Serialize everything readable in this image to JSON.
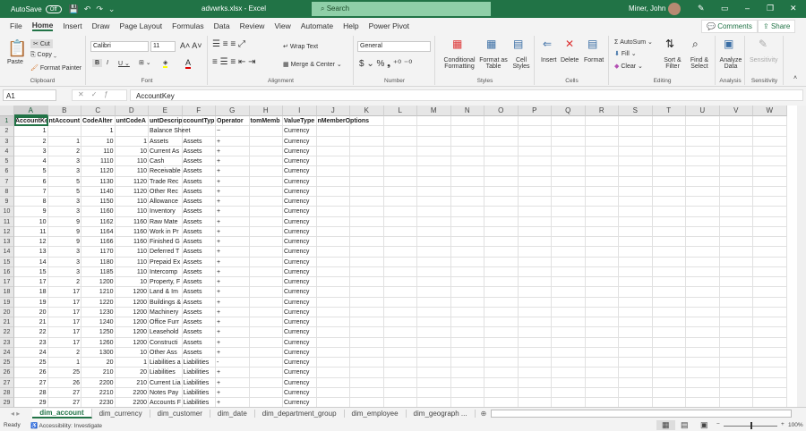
{
  "titlebar": {
    "autosave_label": "AutoSave",
    "autosave_state": "Off",
    "filename": "advwrks.xlsx - Excel",
    "search_placeholder": "Search",
    "user": "Miner, John"
  },
  "menu": {
    "tabs": [
      "File",
      "Home",
      "Insert",
      "Draw",
      "Page Layout",
      "Formulas",
      "Data",
      "Review",
      "View",
      "Automate",
      "Help",
      "Power Pivot"
    ],
    "active": "Home",
    "comments": "Comments",
    "share": "Share"
  },
  "ribbon": {
    "clipboard": {
      "label": "Clipboard",
      "paste": "Paste",
      "cut": "Cut",
      "copy": "Copy",
      "format_painter": "Format Painter"
    },
    "font": {
      "label": "Font",
      "name": "Calibri",
      "size": "11",
      "font_color": "#e00000",
      "fill_color": "#ffff00"
    },
    "alignment": {
      "label": "Alignment",
      "wrap": "Wrap Text",
      "merge": "Merge & Center"
    },
    "number": {
      "label": "Number",
      "format": "General"
    },
    "styles": {
      "label": "Styles",
      "conditional": "Conditional Formatting",
      "table": "Format as Table",
      "cell_styles": "Cell Styles"
    },
    "cells": {
      "label": "Cells",
      "insert": "Insert",
      "delete": "Delete",
      "format": "Format"
    },
    "editing": {
      "label": "Editing",
      "autosum": "AutoSum",
      "fill": "Fill",
      "clear": "Clear",
      "sort": "Sort & Filter",
      "find": "Find & Select"
    },
    "analysis": {
      "label": "Analysis",
      "analyze": "Analyze Data"
    },
    "sensitivity": {
      "label": "Sensitivity",
      "button": "Sensitivity"
    }
  },
  "formula_bar": {
    "name_box": "A1",
    "value": "AccountKey"
  },
  "sheet": {
    "columns": [
      "A",
      "B",
      "C",
      "D",
      "E",
      "F",
      "G",
      "H",
      "I",
      "J",
      "K",
      "L",
      "M",
      "N",
      "O",
      "P",
      "Q",
      "R",
      "S",
      "T",
      "U",
      "V",
      "W"
    ],
    "selected_cell": "A1",
    "header_row": [
      "AccountKe",
      "ntAccount",
      "CodeAlter",
      "untCodeA",
      "untDescrip",
      "ccountTyp",
      "Operator",
      "tomMemb",
      "ValueType",
      "nMemberOptions"
    ],
    "rows": [
      [
        1,
        "",
        1,
        "",
        "Balance Sheet",
        "",
        "~",
        "",
        "Currency"
      ],
      [
        2,
        1,
        10,
        1,
        "Assets",
        "Assets",
        "+",
        "",
        "Currency"
      ],
      [
        3,
        2,
        110,
        10,
        "Current As",
        "Assets",
        "+",
        "",
        "Currency"
      ],
      [
        4,
        3,
        1110,
        110,
        "Cash",
        "Assets",
        "+",
        "",
        "Currency"
      ],
      [
        5,
        3,
        1120,
        110,
        "Receivable",
        "Assets",
        "+",
        "",
        "Currency"
      ],
      [
        6,
        5,
        1130,
        1120,
        "Trade Rec",
        "Assets",
        "+",
        "",
        "Currency"
      ],
      [
        7,
        5,
        1140,
        1120,
        "Other Rec",
        "Assets",
        "+",
        "",
        "Currency"
      ],
      [
        8,
        3,
        1150,
        110,
        "Allowance",
        "Assets",
        "+",
        "",
        "Currency"
      ],
      [
        9,
        3,
        1160,
        110,
        "Inventory",
        "Assets",
        "+",
        "",
        "Currency"
      ],
      [
        10,
        9,
        1162,
        1160,
        "Raw Mate",
        "Assets",
        "+",
        "",
        "Currency"
      ],
      [
        11,
        9,
        1164,
        1160,
        "Work in Pr",
        "Assets",
        "+",
        "",
        "Currency"
      ],
      [
        12,
        9,
        1166,
        1160,
        "Finished G",
        "Assets",
        "+",
        "",
        "Currency"
      ],
      [
        13,
        3,
        1170,
        110,
        "Deferred T",
        "Assets",
        "+",
        "",
        "Currency"
      ],
      [
        14,
        3,
        1180,
        110,
        "Prepaid Ex",
        "Assets",
        "+",
        "",
        "Currency"
      ],
      [
        15,
        3,
        1185,
        110,
        "Intercomp",
        "Assets",
        "+",
        "",
        "Currency"
      ],
      [
        17,
        2,
        1200,
        10,
        "Property, F",
        "Assets",
        "+",
        "",
        "Currency"
      ],
      [
        18,
        17,
        1210,
        1200,
        "Land & Im",
        "Assets",
        "+",
        "",
        "Currency"
      ],
      [
        19,
        17,
        1220,
        1200,
        "Buildings &",
        "Assets",
        "+",
        "",
        "Currency"
      ],
      [
        20,
        17,
        1230,
        1200,
        "Machinery",
        "Assets",
        "+",
        "",
        "Currency"
      ],
      [
        21,
        17,
        1240,
        1200,
        "Office Furr",
        "Assets",
        "+",
        "",
        "Currency"
      ],
      [
        22,
        17,
        1250,
        1200,
        "Leasehold",
        "Assets",
        "+",
        "",
        "Currency"
      ],
      [
        23,
        17,
        1260,
        1200,
        "Constructi",
        "Assets",
        "+",
        "",
        "Currency"
      ],
      [
        24,
        2,
        1300,
        10,
        "Other Ass",
        "Assets",
        "+",
        "",
        "Currency"
      ],
      [
        25,
        1,
        20,
        1,
        "Liabilities a",
        "Liabilities",
        "-",
        "",
        "Currency"
      ],
      [
        26,
        25,
        210,
        20,
        "Liabilities",
        "Liabilities",
        "+",
        "",
        "Currency"
      ],
      [
        27,
        26,
        2200,
        210,
        "Current Lia",
        "Liabilities",
        "+",
        "",
        "Currency"
      ],
      [
        28,
        27,
        2210,
        2200,
        "Notes Pay",
        "Liabilities",
        "+",
        "",
        "Currency"
      ],
      [
        29,
        27,
        2230,
        2200,
        "Accounts F",
        "Liabilities",
        "+",
        "",
        "Currency"
      ]
    ]
  },
  "sheet_tabs": [
    "dim_account",
    "dim_currency",
    "dim_customer",
    "dim_date",
    "dim_department_group",
    "dim_employee",
    "dim_geograph ..."
  ],
  "active_sheet": "dim_account",
  "status": {
    "ready": "Ready",
    "accessibility": "Accessibility: Investigate",
    "zoom": "100%",
    "zoom_level": 100
  }
}
